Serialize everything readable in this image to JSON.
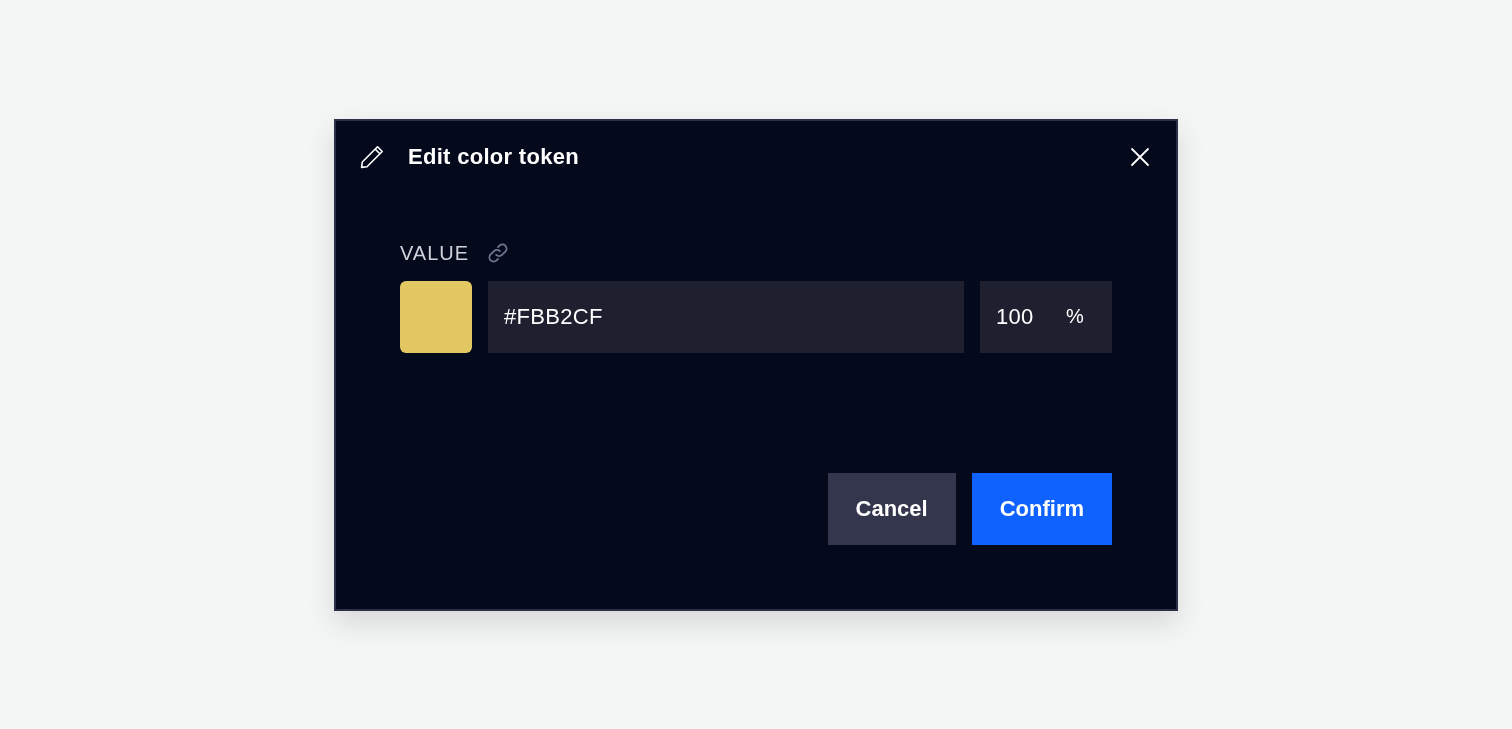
{
  "dialog": {
    "title": "Edit color token"
  },
  "value": {
    "label": "VALUE",
    "swatch": {
      "color": "#e2c762"
    },
    "hex_input": {
      "value": "#FBB2CF"
    },
    "opacity_input": {
      "value": "100",
      "unit": "%"
    }
  },
  "buttons": [
    {
      "label": "Cancel",
      "kind": "secondary"
    },
    {
      "label": "Confirm",
      "kind": "primary"
    }
  ]
}
